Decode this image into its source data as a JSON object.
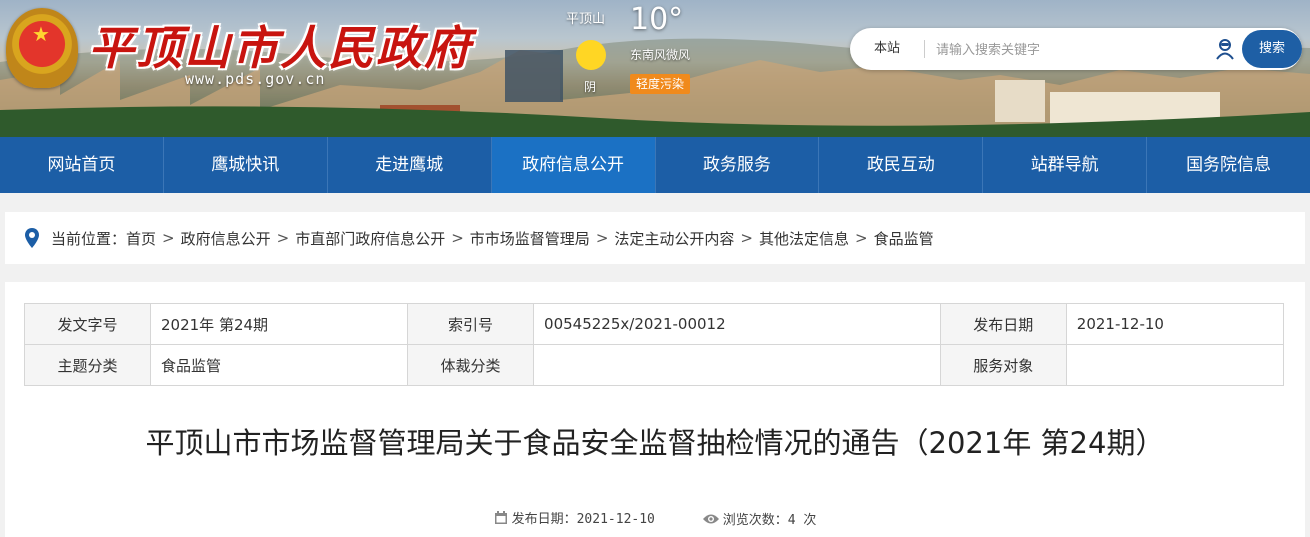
{
  "header": {
    "site_title": "平顶山市人民政府",
    "site_url": "www.pds.gov.cn",
    "weather": {
      "city": "平顶山",
      "temperature": "10°",
      "condition": "阴",
      "wind": "东南风微风",
      "air_quality": "轻度污染"
    },
    "search": {
      "scope": "本站",
      "placeholder": "请输入搜索关键字",
      "button": "搜索"
    }
  },
  "nav": {
    "items": [
      {
        "label": "网站首页"
      },
      {
        "label": "鹰城快讯"
      },
      {
        "label": "走进鹰城"
      },
      {
        "label": "政府信息公开"
      },
      {
        "label": "政务服务"
      },
      {
        "label": "政民互动"
      },
      {
        "label": "站群导航"
      },
      {
        "label": "国务院信息"
      }
    ],
    "active_index": 3
  },
  "breadcrumb": {
    "prefix": "当前位置：",
    "separator": ">",
    "items": [
      "首页",
      "政府信息公开",
      "市直部门政府信息公开",
      "市市场监督管理局",
      "法定主动公开内容",
      "其他法定信息",
      "食品监管"
    ]
  },
  "meta_table": {
    "rows": [
      [
        {
          "key": "发文字号",
          "value": "2021年 第24期"
        },
        {
          "key": "索引号",
          "value": "00545225x/2021-00012"
        },
        {
          "key": "发布日期",
          "value": "2021-12-10"
        }
      ],
      [
        {
          "key": "主题分类",
          "value": "食品监管"
        },
        {
          "key": "体裁分类",
          "value": ""
        },
        {
          "key": "服务对象",
          "value": ""
        }
      ]
    ]
  },
  "article": {
    "title": "平顶山市市场监督管理局关于食品安全监督抽检情况的通告（2021年 第24期）",
    "publish_label": "发布日期：2021-12-10",
    "views_label": "浏览次数：4 次"
  },
  "colors": {
    "nav_bg": "#1c5ea6",
    "nav_active": "#1b71c4",
    "title_red": "#c8140f",
    "search_button": "#1e5fa5",
    "aqi_badge": "#f08a1c"
  }
}
